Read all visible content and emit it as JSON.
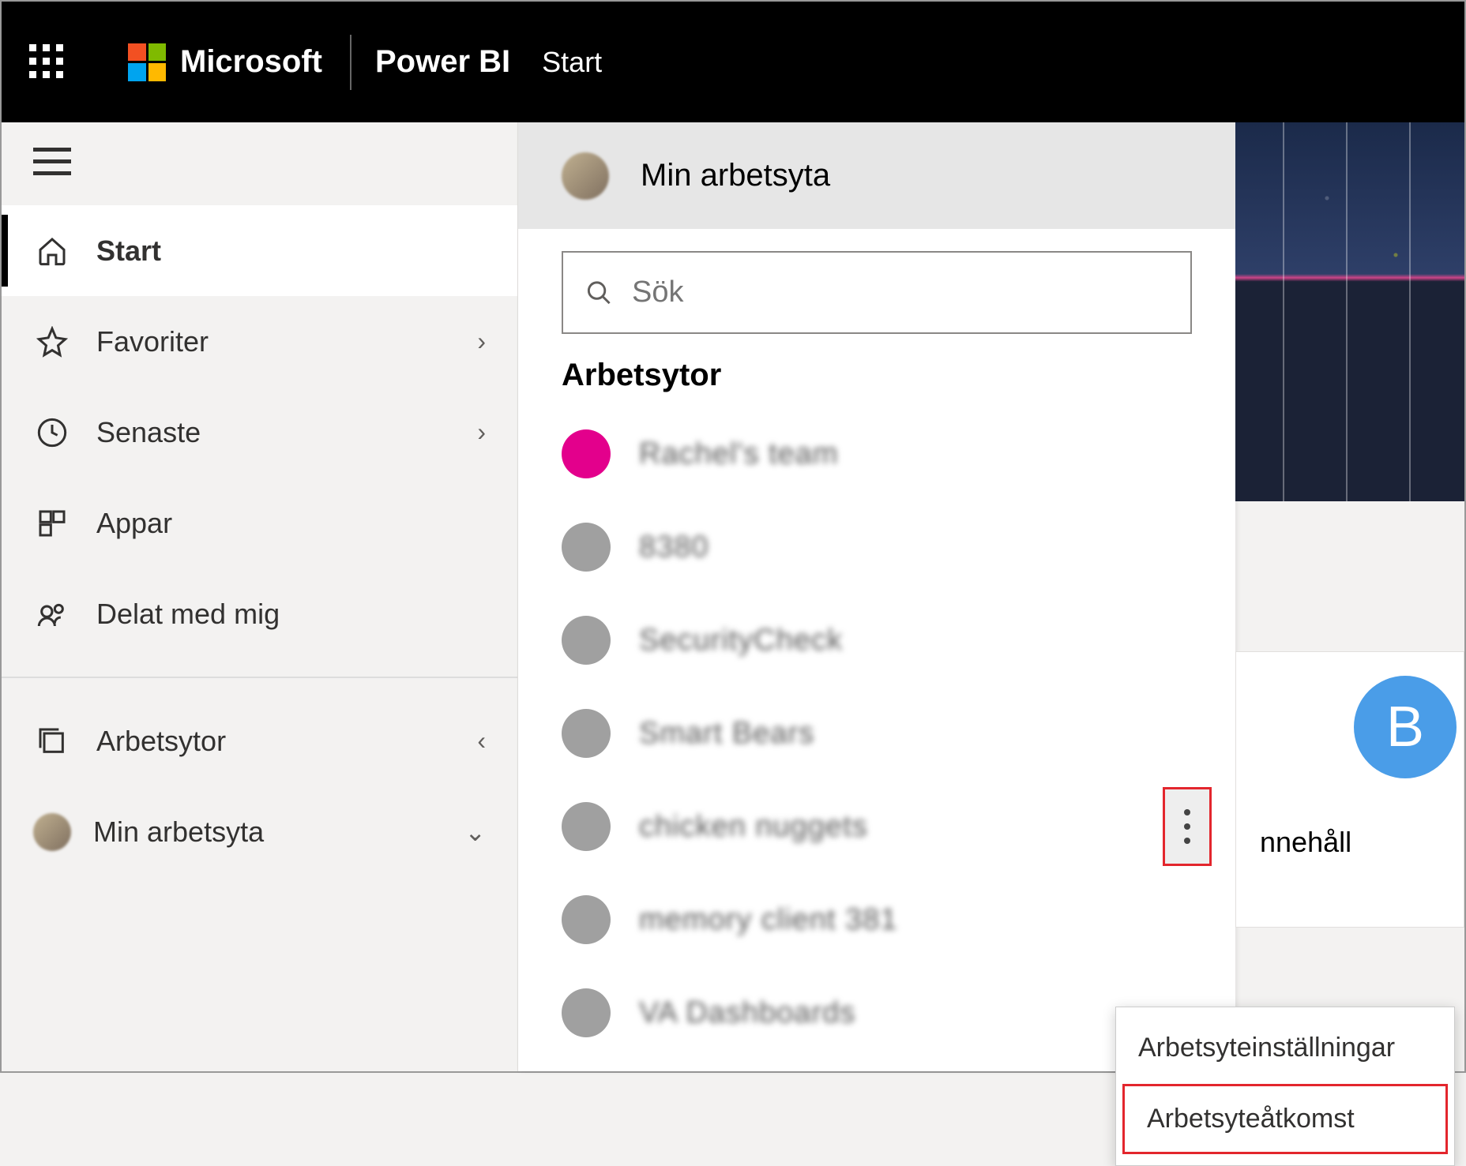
{
  "header": {
    "brand": "Microsoft",
    "suite": "Power BI",
    "page": "Start"
  },
  "sidebar": {
    "items": [
      {
        "label": "Start",
        "icon": "home",
        "active": true
      },
      {
        "label": "Favoriter",
        "icon": "star",
        "chevron": "›"
      },
      {
        "label": "Senaste",
        "icon": "clock",
        "chevron": "›"
      },
      {
        "label": "Appar",
        "icon": "apps"
      },
      {
        "label": "Delat med mig",
        "icon": "shared"
      }
    ],
    "workspaces": {
      "label": "Arbetsytor",
      "chevron": "‹"
    },
    "my_workspace": {
      "label": "Min arbetsyta",
      "chevron": "⌄"
    }
  },
  "flyout": {
    "title": "Min arbetsyta",
    "search_placeholder": "Sök",
    "section": "Arbetsytor",
    "items": [
      {
        "name": "Rachel's team",
        "color": "#e3008c"
      },
      {
        "name": "8380",
        "color": "#a0a0a0"
      },
      {
        "name": "SecurityCheck",
        "color": "#a0a0a0"
      },
      {
        "name": "Smart Bears",
        "color": "#a0a0a0"
      },
      {
        "name": "chicken nuggets",
        "color": "#a0a0a0",
        "more": true
      },
      {
        "name": "memory client 381",
        "color": "#a0a0a0"
      },
      {
        "name": "VA Dashboards",
        "color": "#a0a0a0"
      }
    ]
  },
  "card": {
    "letter": "B",
    "caption": "nnehåll"
  },
  "context_menu": {
    "items": [
      {
        "label": "Arbetsyteinställningar"
      },
      {
        "label": "Arbetsyteåtkomst",
        "highlight": true
      }
    ]
  }
}
